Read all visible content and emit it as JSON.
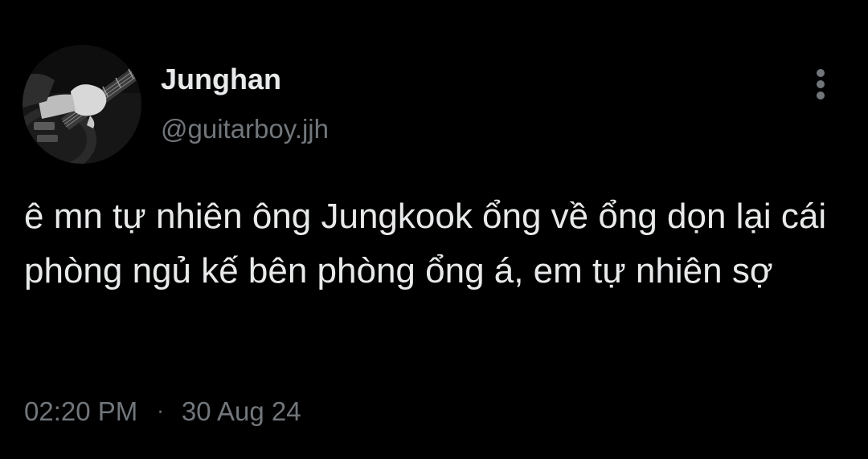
{
  "author": {
    "display_name": "Junghan",
    "handle": "@guitarboy.jjh",
    "avatar": "guitar-player-photo"
  },
  "tweet": {
    "text": "ê mn tự nhiên ông Jungkook ổng về ổng dọn lại cái phòng ngủ kế bên phòng ổng á, em tự nhiên sợ",
    "time": "02:20 PM",
    "separator": "·",
    "date": "30 Aug 24"
  },
  "icons": {
    "more": "more-vertical-icon"
  },
  "colors": {
    "background": "#000000",
    "primary_text": "#e7e9ea",
    "secondary_text": "#71767b"
  }
}
